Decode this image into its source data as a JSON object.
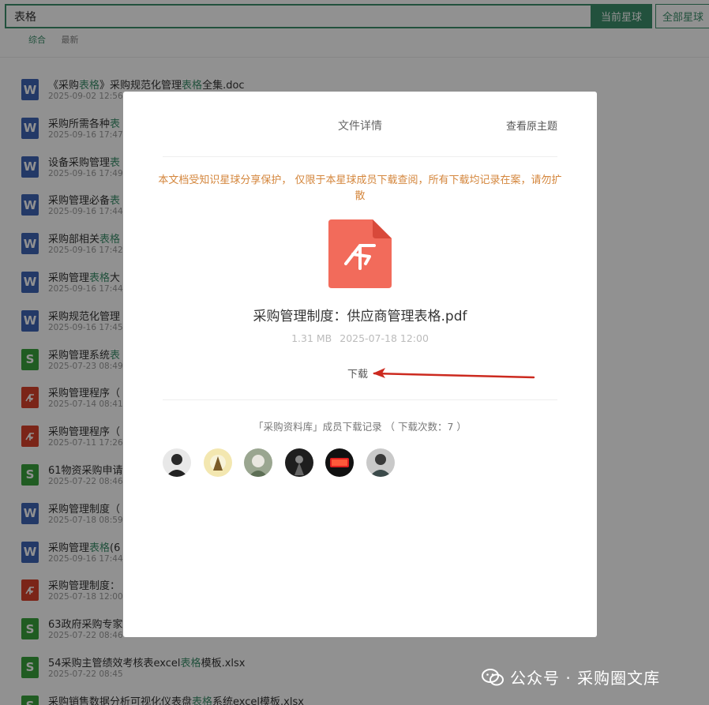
{
  "search": {
    "value": "表格"
  },
  "buttons": {
    "current": "当前星球",
    "all": "全部星球"
  },
  "filters": {
    "all": "综合",
    "latest": "最新"
  },
  "files": [
    {
      "type": "doc",
      "title": [
        "《采购",
        "表格",
        "》采购规范化管理",
        "表格",
        "全集.doc"
      ],
      "date": "2025-09-02 12:56"
    },
    {
      "type": "doc",
      "title": [
        "采购所需各种",
        "表"
      ],
      "date": "2025-09-16 17:47"
    },
    {
      "type": "doc",
      "title": [
        "设备采购管理",
        "表"
      ],
      "date": "2025-09-16 17:49"
    },
    {
      "type": "doc",
      "title": [
        "采购管理必备",
        "表"
      ],
      "date": "2025-09-16 17:44"
    },
    {
      "type": "doc",
      "title": [
        "采购部相关",
        "表格"
      ],
      "date": "2025-09-16 17:42"
    },
    {
      "type": "doc",
      "title": [
        "采购管理",
        "表格",
        "大"
      ],
      "date": "2025-09-16 17:44"
    },
    {
      "type": "doc",
      "title": [
        "采购规范化管理",
        ""
      ],
      "date": "2025-09-16 17:45"
    },
    {
      "type": "xls",
      "title": [
        "采购管理系统",
        "表"
      ],
      "date": "2025-07-23 08:49"
    },
    {
      "type": "pdf",
      "title": [
        "采购管理程序（",
        ""
      ],
      "date": "2025-07-14 08:41"
    },
    {
      "type": "pdf",
      "title": [
        "采购管理程序（",
        ""
      ],
      "date": "2025-07-11 17:26"
    },
    {
      "type": "xls",
      "title": [
        "61物资采购申请",
        ""
      ],
      "date": "2025-07-22 08:46"
    },
    {
      "type": "doc",
      "title": [
        "采购管理制度（",
        ""
      ],
      "date": "2025-07-18 08:59"
    },
    {
      "type": "doc",
      "title": [
        "采购管理",
        "表格",
        "(6"
      ],
      "date": "2025-09-16 17:44"
    },
    {
      "type": "pdf",
      "title": [
        "采购管理制度：",
        ""
      ],
      "date": "2025-07-18 12:00"
    },
    {
      "type": "xls",
      "title": [
        "63政府采购专家",
        ""
      ],
      "date": "2025-07-22 08:46"
    },
    {
      "type": "xls",
      "title": [
        "54采购主管绩效考核表excel",
        "表格",
        "模板.xlsx"
      ],
      "date": "2025-07-22 08:45"
    },
    {
      "type": "xls",
      "title": [
        "采购销售数据分析可视化仪表盘",
        "表格",
        "系统excel模板.xlsx"
      ],
      "date": ""
    }
  ],
  "modal": {
    "title": "文件详情",
    "view_original": "查看原主题",
    "notice": "本文档受知识星球分享保护， 仅限于本星球成员下载查阅，所有下载均记录在案，请勿扩散",
    "file_name": "采购管理制度：供应商管理表格.pdf",
    "file_size": "1.31 MB",
    "file_date": "2025-07-18 12:00",
    "download": "下载",
    "download_record": "「采购资料库」成员下载记录 （ 下载次数：7 ）"
  },
  "watermark": "公众号 · 采购圈文库",
  "colors": {
    "brand": "#3d8f6c",
    "notice": "#d4863c",
    "pdf": "#f26b5b"
  }
}
